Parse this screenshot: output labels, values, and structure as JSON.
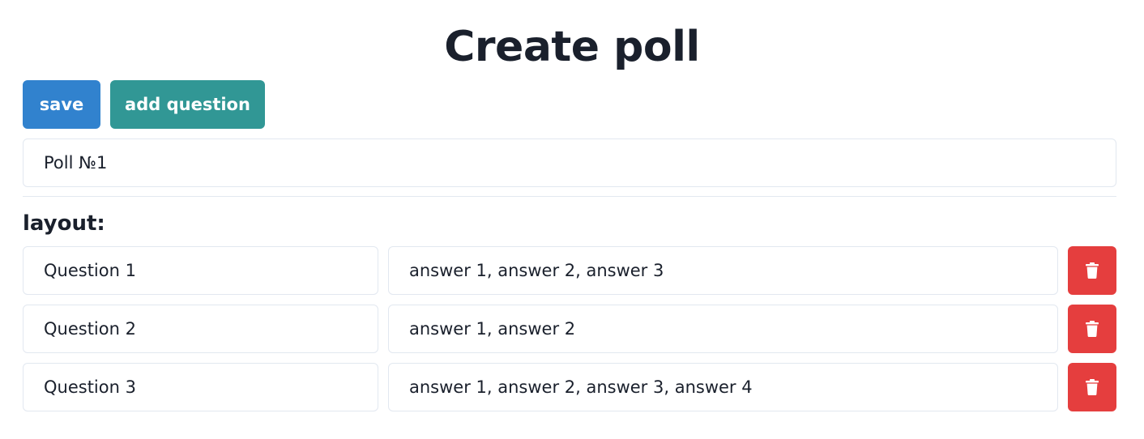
{
  "page": {
    "title": "Create poll"
  },
  "toolbar": {
    "save_label": "save",
    "add_question_label": "add question"
  },
  "poll": {
    "title_value": "Poll №1"
  },
  "layout": {
    "label": "layout:",
    "questions": [
      {
        "question": "Question 1",
        "answers": "answer 1, answer 2, answer 3"
      },
      {
        "question": "Question 2",
        "answers": "answer 1, answer 2"
      },
      {
        "question": "Question 3",
        "answers": "answer 1, answer 2, answer 3, answer 4"
      }
    ]
  },
  "colors": {
    "save": "#3182ce",
    "add": "#319795",
    "delete": "#e53e3e",
    "text": "#1a202c",
    "border": "#e2e8f0"
  },
  "icons": {
    "delete": "trash-icon"
  }
}
